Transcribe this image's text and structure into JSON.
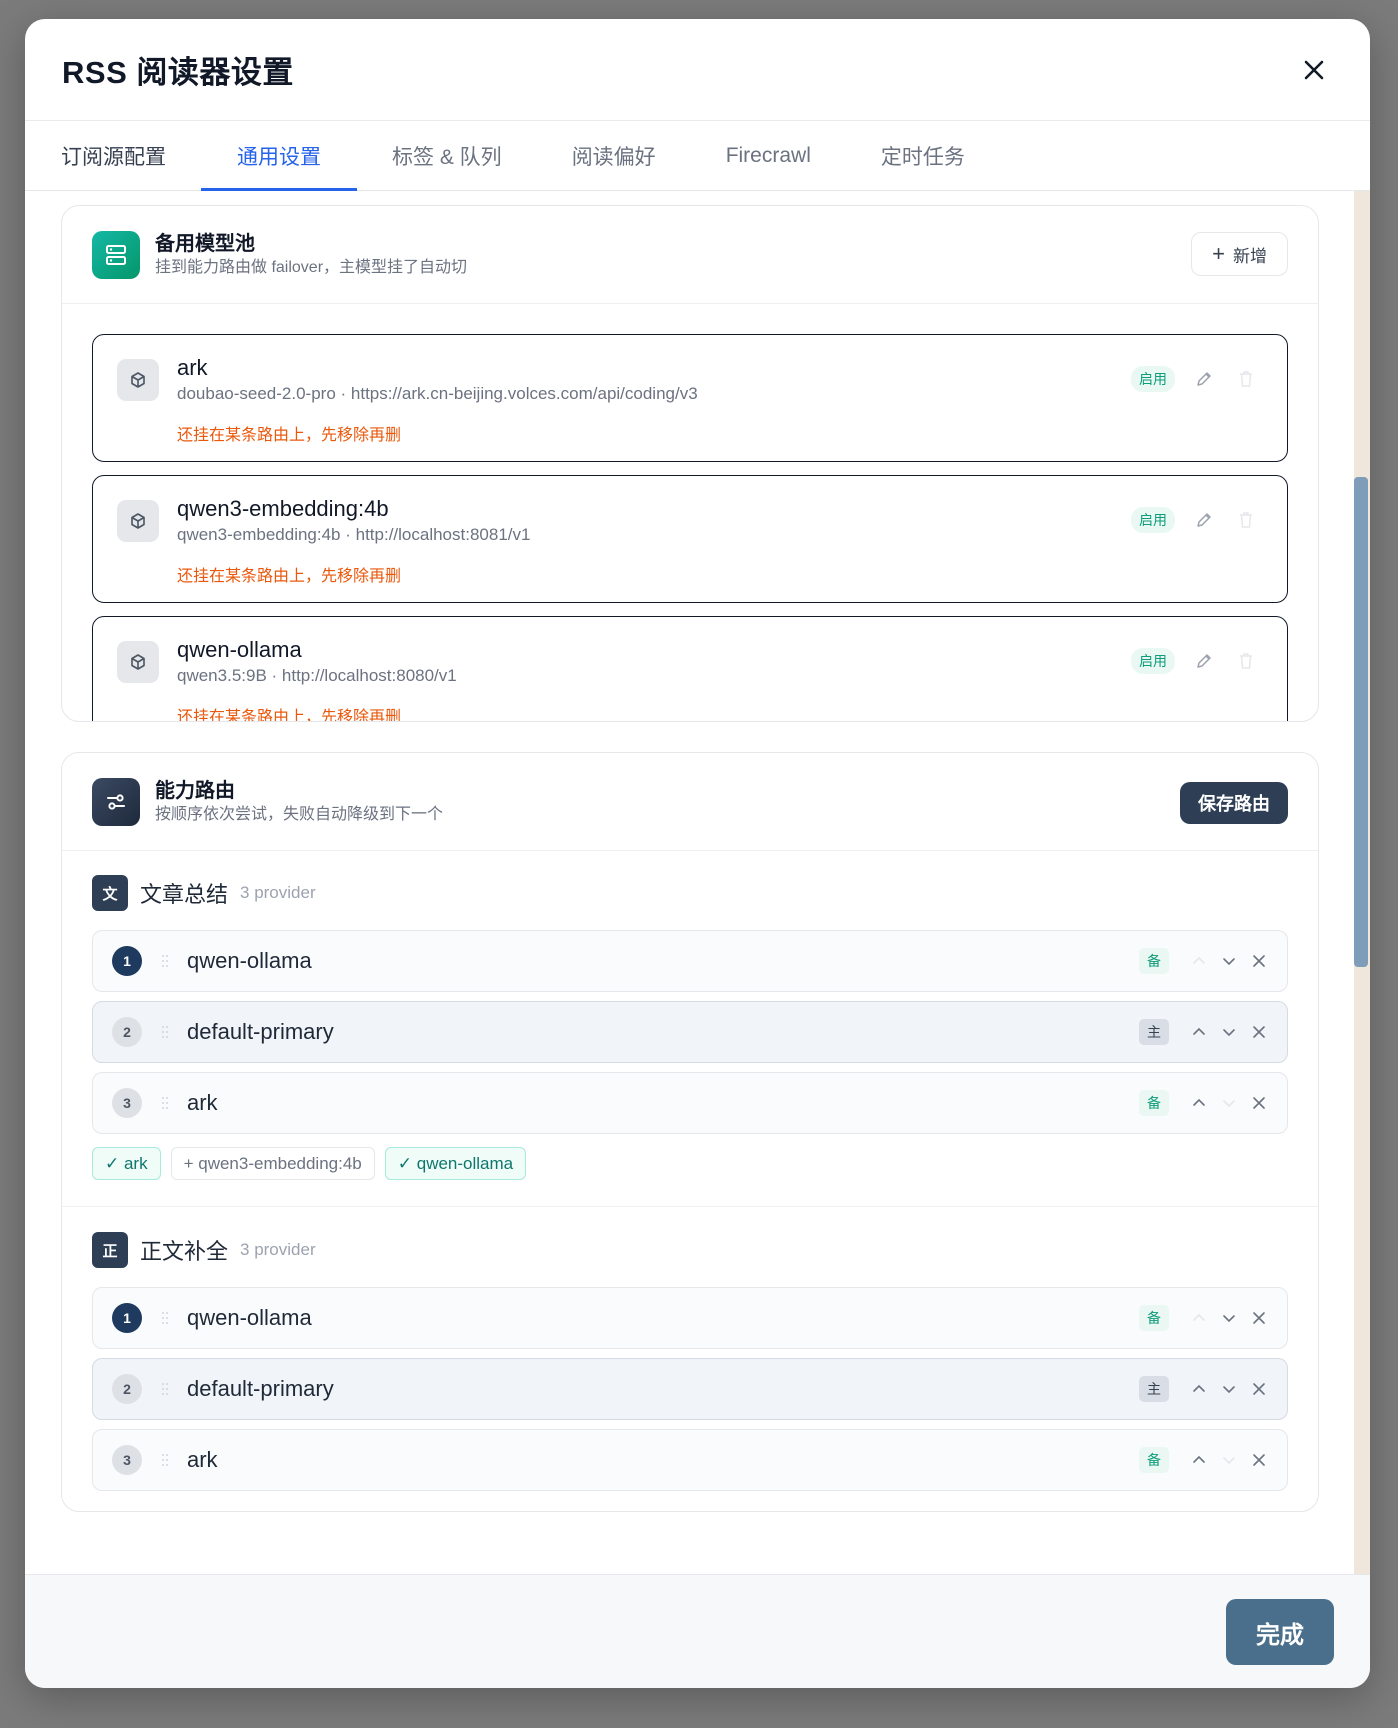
{
  "modal": {
    "title": "RSS 阅读器设置",
    "done_label": "完成"
  },
  "tabs": [
    {
      "label": "订阅源配置"
    },
    {
      "label": "通用设置"
    },
    {
      "label": "标签 & 队列"
    },
    {
      "label": "阅读偏好"
    },
    {
      "label": "Firecrawl"
    },
    {
      "label": "定时任务"
    }
  ],
  "active_tab": "通用设置",
  "backup_pool": {
    "title": "备用模型池",
    "subtitle": "挂到能力路由做 failover，主模型挂了自动切",
    "add_label": "新增",
    "models": [
      {
        "name": "ark",
        "meta": "doubao-seed-2.0-pro · https://ark.cn-beijing.volces.com/api/coding/v3",
        "warning": "还挂在某条路由上，先移除再删",
        "status": "启用"
      },
      {
        "name": "qwen3-embedding:4b",
        "meta": "qwen3-embedding:4b · http://localhost:8081/v1",
        "warning": "还挂在某条路由上，先移除再删",
        "status": "启用"
      },
      {
        "name": "qwen-ollama",
        "meta": "qwen3.5:9B · http://localhost:8080/v1",
        "warning": "还挂在某条路由上，先移除再删",
        "status": "启用"
      }
    ]
  },
  "routing": {
    "title": "能力路由",
    "subtitle": "按顺序依次尝试，失败自动降级到下一个",
    "save_label": "保存路由",
    "groups": [
      {
        "badge": "文",
        "name": "文章总结",
        "count": "3 provider",
        "rows": [
          {
            "num": "1",
            "label": "qwen-ollama",
            "tag": "备"
          },
          {
            "num": "2",
            "label": "default-primary",
            "tag": "主"
          },
          {
            "num": "3",
            "label": "ark",
            "tag": "备"
          }
        ],
        "chips": [
          {
            "label": "✓ ark",
            "on": true
          },
          {
            "label": "+ qwen3-embedding:4b",
            "on": false
          },
          {
            "label": "✓ qwen-ollama",
            "on": true
          }
        ]
      },
      {
        "badge": "正",
        "name": "正文补全",
        "count": "3 provider",
        "rows": [
          {
            "num": "1",
            "label": "qwen-ollama",
            "tag": "备"
          },
          {
            "num": "2",
            "label": "default-primary",
            "tag": "主"
          },
          {
            "num": "3",
            "label": "ark",
            "tag": "备"
          }
        ]
      }
    ]
  },
  "colors": {
    "accent": "#2563eb",
    "warning": "#ea580c",
    "success": "#0f9d7a",
    "dark": "#2d3e55"
  }
}
